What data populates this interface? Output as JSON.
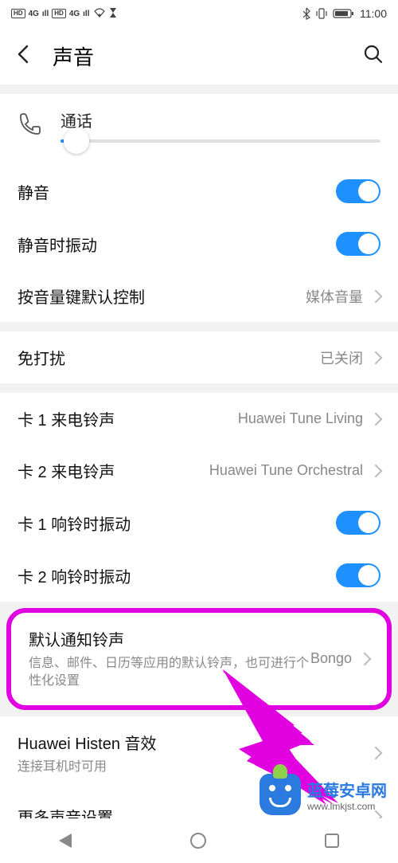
{
  "statusbar": {
    "hd1": "HD",
    "hd2": "HD",
    "sig": "4G",
    "time": "11:00"
  },
  "header": {
    "title": "声音"
  },
  "volume": {
    "label": "通话",
    "percent": 5
  },
  "rows": {
    "silent": {
      "label": "静音",
      "on": true
    },
    "vibrate_silent": {
      "label": "静音时振动",
      "on": true
    },
    "vol_key": {
      "label": "按音量键默认控制",
      "value": "媒体音量"
    },
    "dnd": {
      "label": "免打扰",
      "value": "已关闭"
    },
    "sim1_ring": {
      "label": "卡 1 来电铃声",
      "value": "Huawei Tune Living"
    },
    "sim2_ring": {
      "label": "卡 2 来电铃声",
      "value": "Huawei Tune Orchestral"
    },
    "sim1_vib": {
      "label": "卡 1 响铃时振动",
      "on": true
    },
    "sim2_vib": {
      "label": "卡 2 响铃时振动",
      "on": true
    },
    "default_notif": {
      "label": "默认通知铃声",
      "sub": "信息、邮件、日历等应用的默认铃声，也可进行个性化设置",
      "value": "Bongo"
    },
    "histen": {
      "label": "Huawei Histen 音效",
      "sub": "连接耳机时可用"
    },
    "more": {
      "label": "更多声音设置"
    }
  },
  "watermark": {
    "title": "蓝莓安卓网",
    "url": "www.lmkjst.com"
  }
}
